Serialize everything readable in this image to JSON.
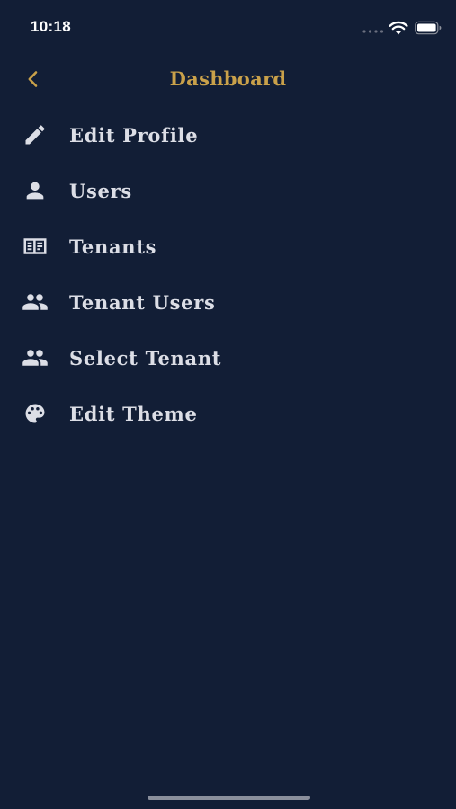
{
  "status_bar": {
    "time": "10:18"
  },
  "header": {
    "title": "Dashboard",
    "back_icon": "chevron-left-icon"
  },
  "menu": {
    "items": [
      {
        "label": "Edit Profile",
        "icon": "pencil-icon"
      },
      {
        "label": "Users",
        "icon": "person-icon"
      },
      {
        "label": "Tenants",
        "icon": "building-list-icon"
      },
      {
        "label": "Tenant Users",
        "icon": "people-icon"
      },
      {
        "label": "Select Tenant",
        "icon": "people-icon"
      },
      {
        "label": "Edit Theme",
        "icon": "palette-icon"
      }
    ]
  },
  "colors": {
    "background": "#121e36",
    "accent": "#c9a14a",
    "text": "#dcdee6"
  }
}
